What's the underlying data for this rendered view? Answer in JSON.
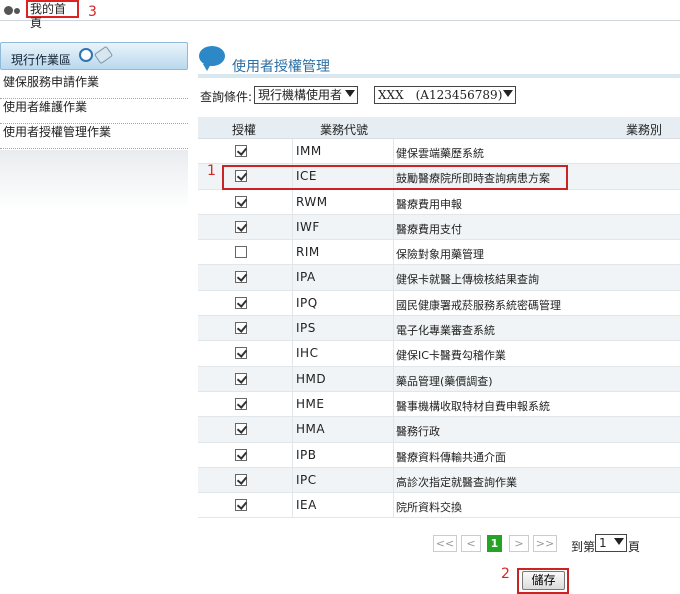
{
  "breadcrumb": {
    "home": "我的首頁"
  },
  "annotations": {
    "a1": "1",
    "a2": "2",
    "a3": "3",
    "accent": "#d22222"
  },
  "sidebar": {
    "header": "現行作業區",
    "items": [
      {
        "label": "健保服務申請作業"
      },
      {
        "label": "使用者維護作業"
      },
      {
        "label": "使用者授權管理作業"
      }
    ]
  },
  "main": {
    "title": "使用者授權管理",
    "query_label": "查詢條件:",
    "filter_select": "現行機構使用者",
    "user_select": "XXX　(A123456789)",
    "columns": {
      "auth": "授權",
      "code": "業務代號",
      "category": "業務別"
    },
    "rows": [
      {
        "checked": true,
        "code": "IMM",
        "name": "健保雲端藥歷系統"
      },
      {
        "checked": true,
        "code": "ICE",
        "name": "鼓勵醫療院所即時查詢病患方案"
      },
      {
        "checked": true,
        "code": "RWM",
        "name": "醫療費用申報"
      },
      {
        "checked": true,
        "code": "IWF",
        "name": "醫療費用支付"
      },
      {
        "checked": false,
        "code": "RIM",
        "name": "保險對象用藥管理"
      },
      {
        "checked": true,
        "code": "IPA",
        "name": "健保卡就醫上傳檢核結果查詢"
      },
      {
        "checked": true,
        "code": "IPQ",
        "name": "國民健康署戒菸服務系統密碼管理"
      },
      {
        "checked": true,
        "code": "IPS",
        "name": "電子化專業審查系統"
      },
      {
        "checked": true,
        "code": "IHC",
        "name": "健保IC卡醫費勾稽作業"
      },
      {
        "checked": true,
        "code": "HMD",
        "name": "藥品管理(藥價調查)"
      },
      {
        "checked": true,
        "code": "HME",
        "name": "醫事機構收取特材自費申報系統"
      },
      {
        "checked": true,
        "code": "HMA",
        "name": "醫務行政"
      },
      {
        "checked": true,
        "code": "IPB",
        "name": "醫療資料傳輸共通介面"
      },
      {
        "checked": true,
        "code": "IPC",
        "name": "高診次指定就醫查詢作業"
      },
      {
        "checked": true,
        "code": "IEA",
        "name": "院所資料交換"
      }
    ]
  },
  "pager": {
    "first": "<<",
    "prev": "<",
    "current": "1",
    "next": ">",
    "last": ">>",
    "goto_label": "到第",
    "page_select": "1",
    "page_suffix": "頁"
  },
  "save_label": "儲存"
}
